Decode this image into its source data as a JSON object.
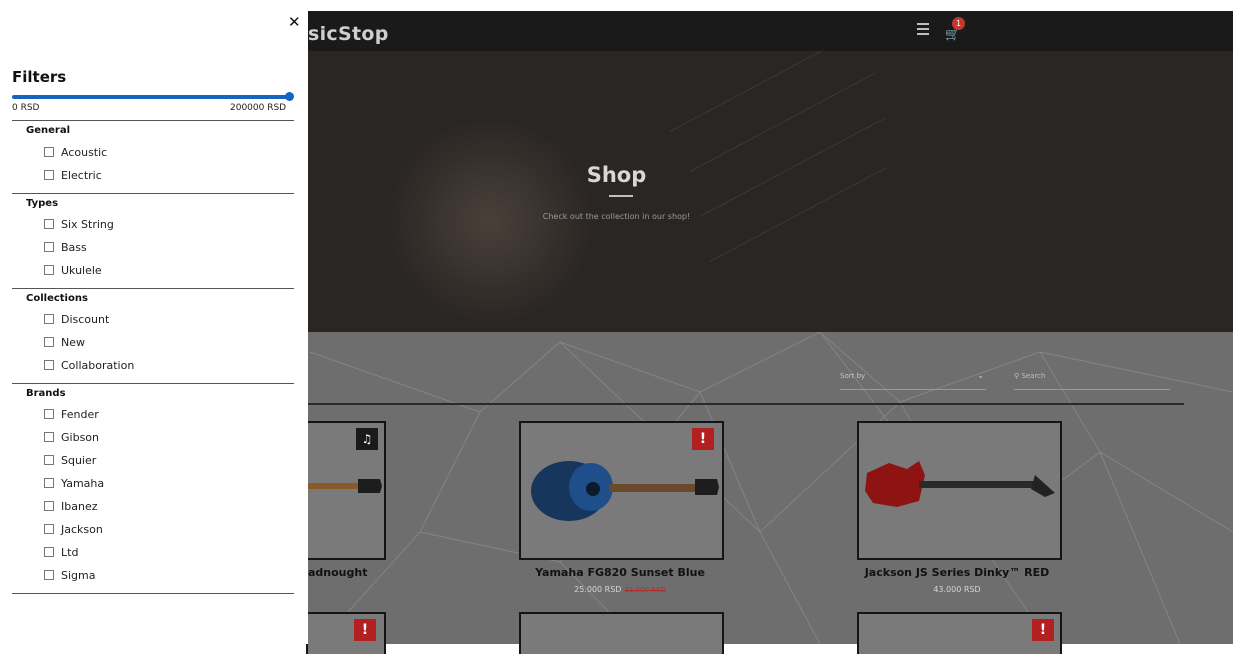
{
  "navbar": {
    "brand": "sicStop",
    "cart_count": "1"
  },
  "hero": {
    "title": "Shop",
    "subtitle": "Check out the collection in our shop!"
  },
  "toolbar": {
    "sort_label": "Sort by",
    "search_placeholder": "Search"
  },
  "products": [
    {
      "title": "adnought",
      "price": "",
      "old_price": "",
      "badge": "guitar"
    },
    {
      "title": "Yamaha FG820 Sunset Blue",
      "price": "25.000 RSD",
      "old_price": "32.000 RSD",
      "badge": "!"
    },
    {
      "title": "Jackson JS Series Dinky™ RED",
      "price": "43.000 RSD",
      "old_price": "",
      "badge": ""
    }
  ],
  "filters": {
    "title": "Filters",
    "price_range": {
      "min_label": "0 RSD",
      "max_label": "200000 RSD"
    },
    "groups": [
      {
        "title": "General",
        "options": [
          "Acoustic",
          "Electric"
        ]
      },
      {
        "title": "Types",
        "options": [
          "Six String",
          "Bass",
          "Ukulele"
        ]
      },
      {
        "title": "Collections",
        "options": [
          "Discount",
          "New",
          "Collaboration"
        ]
      },
      {
        "title": "Brands",
        "options": [
          "Fender",
          "Gibson",
          "Squier",
          "Yamaha",
          "Ibanez",
          "Jackson",
          "Ltd",
          "Sigma"
        ]
      }
    ]
  },
  "colors": {
    "accent": "#1565c0",
    "badge_red": "#b32020"
  }
}
